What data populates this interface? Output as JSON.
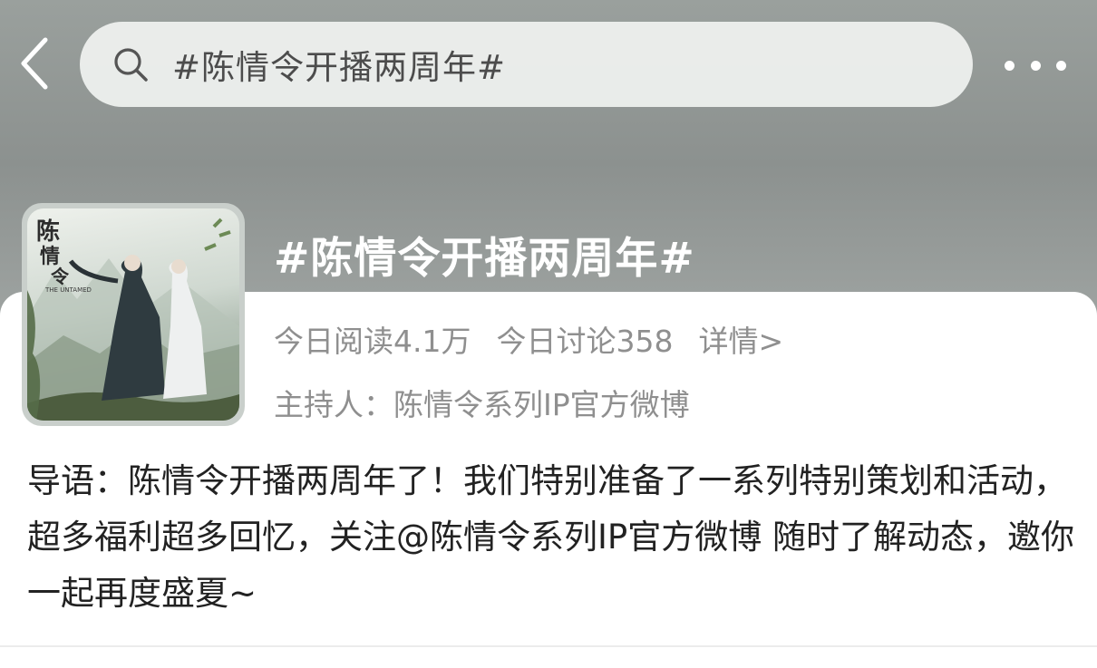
{
  "search": {
    "query": "#陈情令开播两周年#"
  },
  "topic": {
    "title": "#陈情令开播两周年#",
    "stats": {
      "reads": "今日阅读4.1万",
      "discussions": "今日讨论358",
      "detail_link": "详情>"
    },
    "host": "主持人：陈情令系列IP官方微博",
    "cover": {
      "logo_text": "THE UNTAMED"
    }
  },
  "intro": {
    "prefix": "导语：陈情令开播两周年了！我们特别准备了一系列特别策划和活动，超多福利超多回忆，关注",
    "mention": "@陈情令系列IP官方微博",
    "suffix": " 随时了解动态，邀你一起再度盛夏~"
  }
}
